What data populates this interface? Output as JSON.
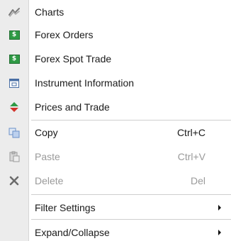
{
  "menu": {
    "items": [
      {
        "label": "Charts",
        "icon": "chart-icon"
      },
      {
        "label": "Forex Orders",
        "icon": "forex-orders-icon"
      },
      {
        "label": "Forex Spot Trade",
        "icon": "forex-spot-trade-icon"
      },
      {
        "label": "Instrument Information",
        "icon": "instrument-info-icon"
      },
      {
        "label": "Prices and Trade",
        "icon": "up-down-arrows-icon"
      },
      {
        "label": "Copy",
        "shortcut": "Ctrl+C",
        "icon": "copy-icon",
        "enabled": true
      },
      {
        "label": "Paste",
        "shortcut": "Ctrl+V",
        "icon": "paste-icon",
        "enabled": false
      },
      {
        "label": "Delete",
        "shortcut": "Del",
        "icon": "delete-x-icon",
        "enabled": false
      },
      {
        "label": "Filter Settings",
        "submenu": true
      },
      {
        "label": "Expand/Collapse",
        "submenu": true
      }
    ]
  },
  "colors": {
    "gutter": "#ececec",
    "disabled_text": "#9a9a9a",
    "green_icon": "#2f9a45",
    "arrow_up": "#2f9a45",
    "arrow_down": "#d2332b",
    "copy_icon": "#6a8fc8"
  }
}
